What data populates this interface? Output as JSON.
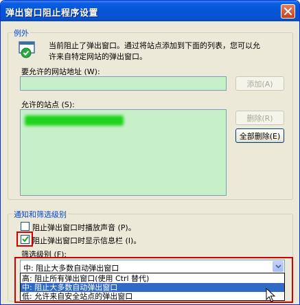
{
  "window": {
    "title": "弹出窗口阻止程序设置",
    "close_icon": "close-icon"
  },
  "exceptions": {
    "group_label": "例外",
    "info_icon": "popup-blocker-info-icon",
    "info_line1": "当前阻止了弹出窗口。通过将站点添加到下面的列表，您可以允",
    "info_line2": "许来自特定网站的弹出窗口。",
    "address_label": "要允许的网站地址 (W):",
    "address_value": "",
    "add_button": "添加(A)",
    "allowed_label": "允许的站点 (S):",
    "remove_button": "删除(R)",
    "remove_all_button": "全部删除(E)"
  },
  "notify": {
    "group_label": "通知和筛选级别",
    "play_sound_label": "阻止弹出窗口时播放声音 (P)。",
    "play_sound_checked": false,
    "show_infobar_label": "阻止弹出窗口时显示信息栏 (I)。",
    "show_infobar_checked": true,
    "filter_label": "筛选级别 (F):",
    "filter_selected": "中: 阻止大多数自动弹出窗口",
    "filter_options": [
      "高: 阻止所有弹出窗口(使用 Ctrl 替代)",
      "中: 阻止大多数自动弹出窗口",
      "低: 允许来自安全站点的弹出窗口"
    ],
    "highlighted_option_index": 1
  },
  "colors": {
    "title_bar": "#0454d6",
    "group_label": "#0046d5",
    "field_background": "#c8f0c8",
    "annotation_red": "#d40000",
    "selection": "#316ac5"
  }
}
